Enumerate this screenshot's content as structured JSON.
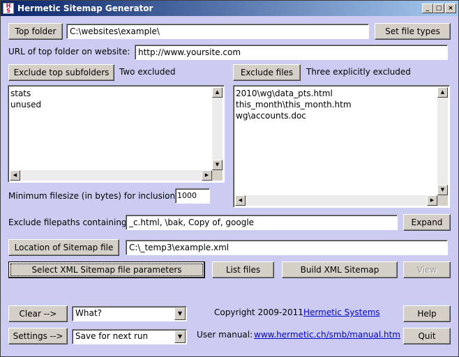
{
  "window": {
    "title": "Hermetic Sitemap Generator",
    "icon_name": "hsg-app-icon",
    "controls": {
      "minimize": "_",
      "maximize": "□",
      "close": "×"
    }
  },
  "top_folder": {
    "button": "Top folder",
    "value": "C:\\websites\\example\\"
  },
  "file_types_button": "Set file types",
  "url": {
    "label": "URL of top folder on website:",
    "value": "http://www.yoursite.com"
  },
  "exclude_subfolders": {
    "button": "Exclude top subfolders",
    "status": "Two excluded",
    "items": [
      "stats",
      "unused"
    ]
  },
  "exclude_files": {
    "button": "Exclude files",
    "status": "Three explicitly excluded",
    "items": [
      "2010\\wg\\data_pts.html",
      "this_month\\this_month.htm",
      "wg\\accounts.doc"
    ]
  },
  "min_filesize": {
    "label": "Minimum filesize (in bytes) for inclusion:",
    "value": "1000"
  },
  "exclude_paths": {
    "label": "Exclude filepaths containing:",
    "value": "_c.html, \\bak, Copy of, google",
    "expand_button": "Expand"
  },
  "sitemap_location": {
    "button": "Location of Sitemap file",
    "value": "C:\\_temp3\\example.xml"
  },
  "actions": {
    "select_params": "Select XML Sitemap file parameters",
    "list_files": "List files",
    "build": "Build XML Sitemap",
    "view": "View"
  },
  "clear": {
    "button": "Clear -->",
    "selected": "What?"
  },
  "settings": {
    "button": "Settings -->",
    "selected": "Save for next run"
  },
  "footer": {
    "copyright": "Copyright 2009-2011",
    "company_link": "Hermetic Systems",
    "manual_label": "User manual:",
    "manual_link": "www.hermetic.ch/smb/manual.htm",
    "help_button": "Help",
    "quit_button": "Quit"
  }
}
